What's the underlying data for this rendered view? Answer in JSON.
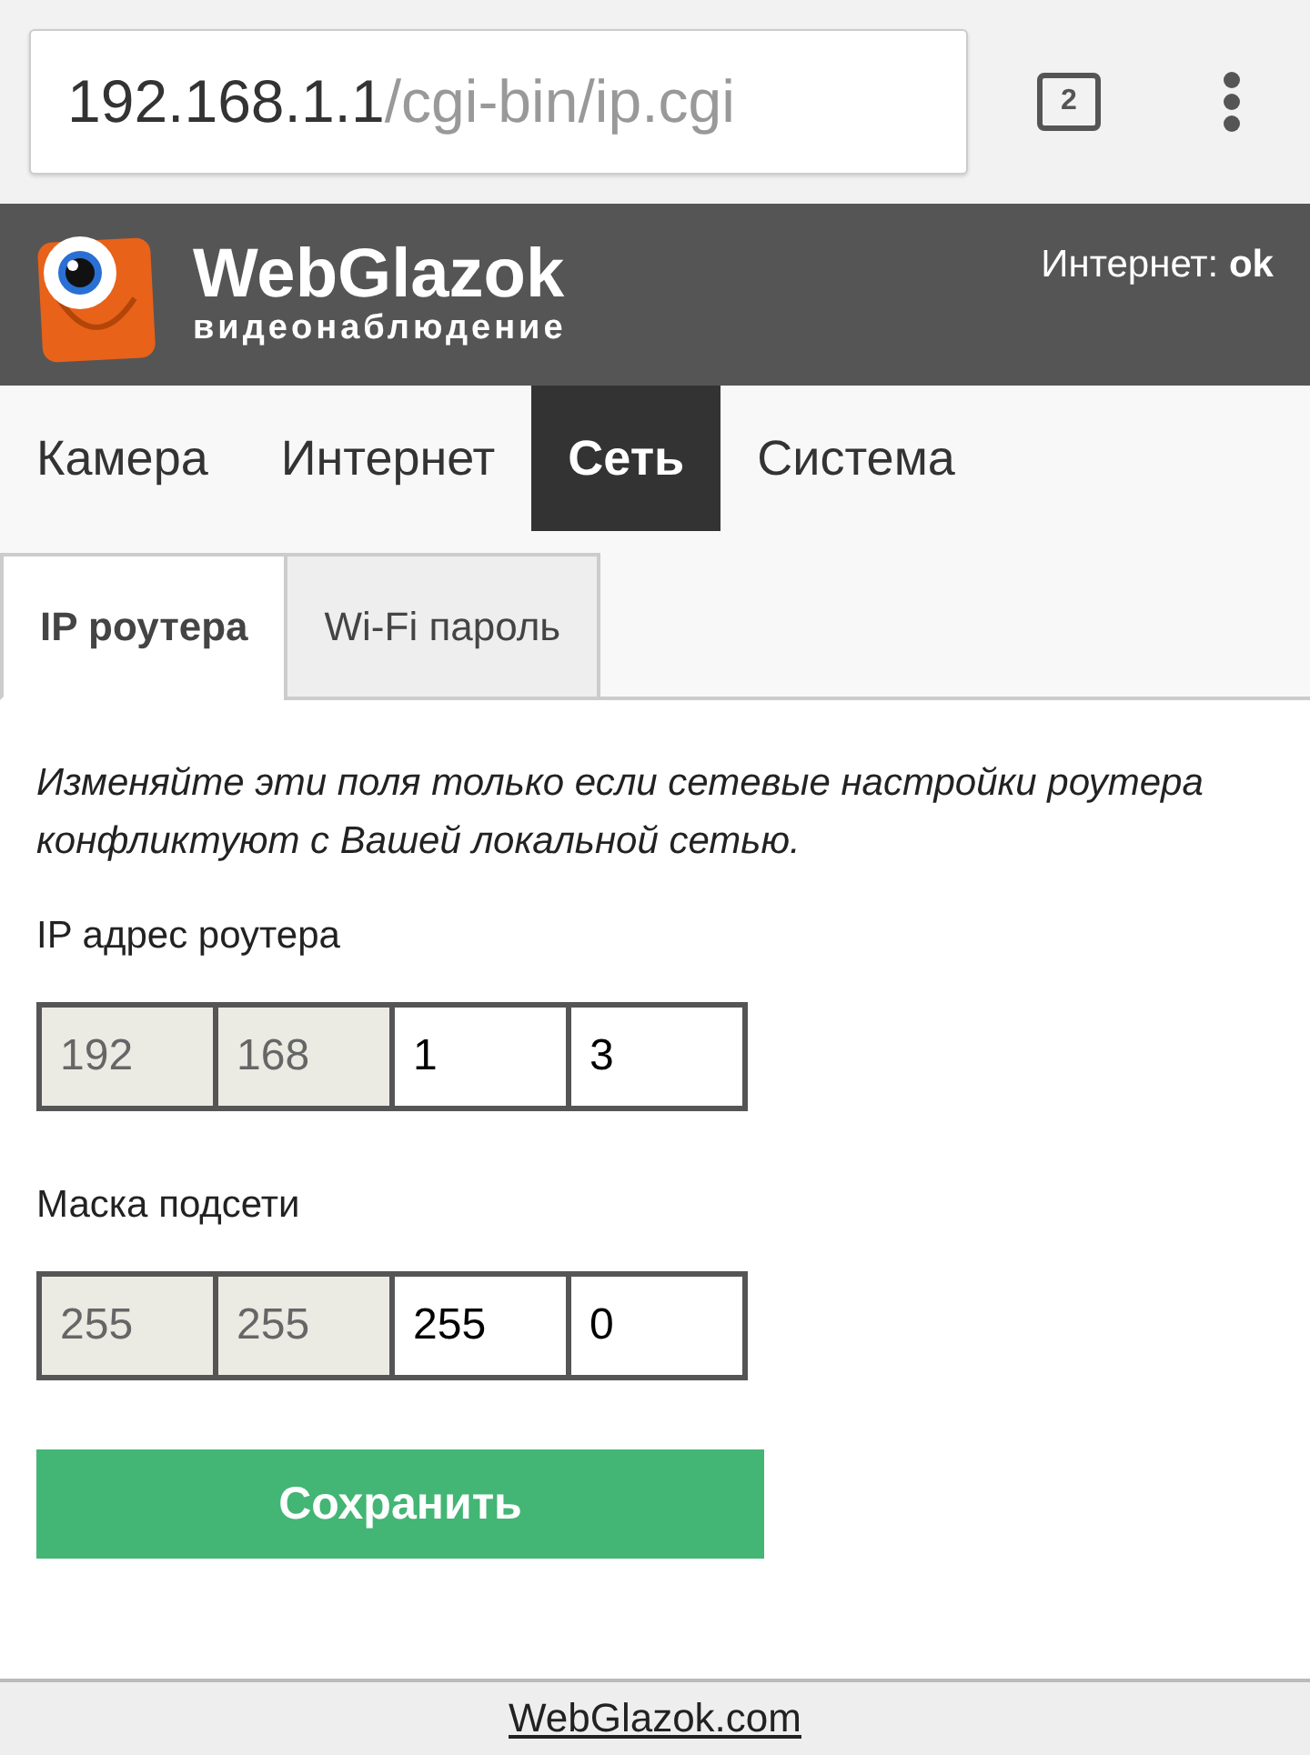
{
  "browser": {
    "url_host": "192.168.1.1",
    "url_path": "/cgi-bin/ip.cgi",
    "tab_count": "2"
  },
  "header": {
    "brand": "WebGlazok",
    "tagline": "видеонаблюдение",
    "status_label": "Интернет:",
    "status_value": "ok"
  },
  "nav": [
    {
      "label": "Камера",
      "selected": false
    },
    {
      "label": "Интернет",
      "selected": false
    },
    {
      "label": "Сеть",
      "selected": true
    },
    {
      "label": "Система",
      "selected": false
    }
  ],
  "subtabs": [
    {
      "label": "IP роутера",
      "selected": true
    },
    {
      "label": "Wi-Fi пароль",
      "selected": false
    }
  ],
  "note": "Изменяйте эти поля только если сетевые настройки роутера конфликтуют с Вашей локальной сетью.",
  "fields": [
    {
      "label": "IP адрес роутера",
      "octets": [
        {
          "value": "192",
          "disabled": true
        },
        {
          "value": "168",
          "disabled": true
        },
        {
          "value": "1",
          "disabled": false
        },
        {
          "value": "3",
          "disabled": false
        }
      ]
    },
    {
      "label": "Маска подсети",
      "octets": [
        {
          "value": "255",
          "disabled": true
        },
        {
          "value": "255",
          "disabled": true
        },
        {
          "value": "255",
          "disabled": false
        },
        {
          "value": "0",
          "disabled": false
        }
      ]
    }
  ],
  "save_button": "Сохранить",
  "footer_link": "WebGlazok.com"
}
